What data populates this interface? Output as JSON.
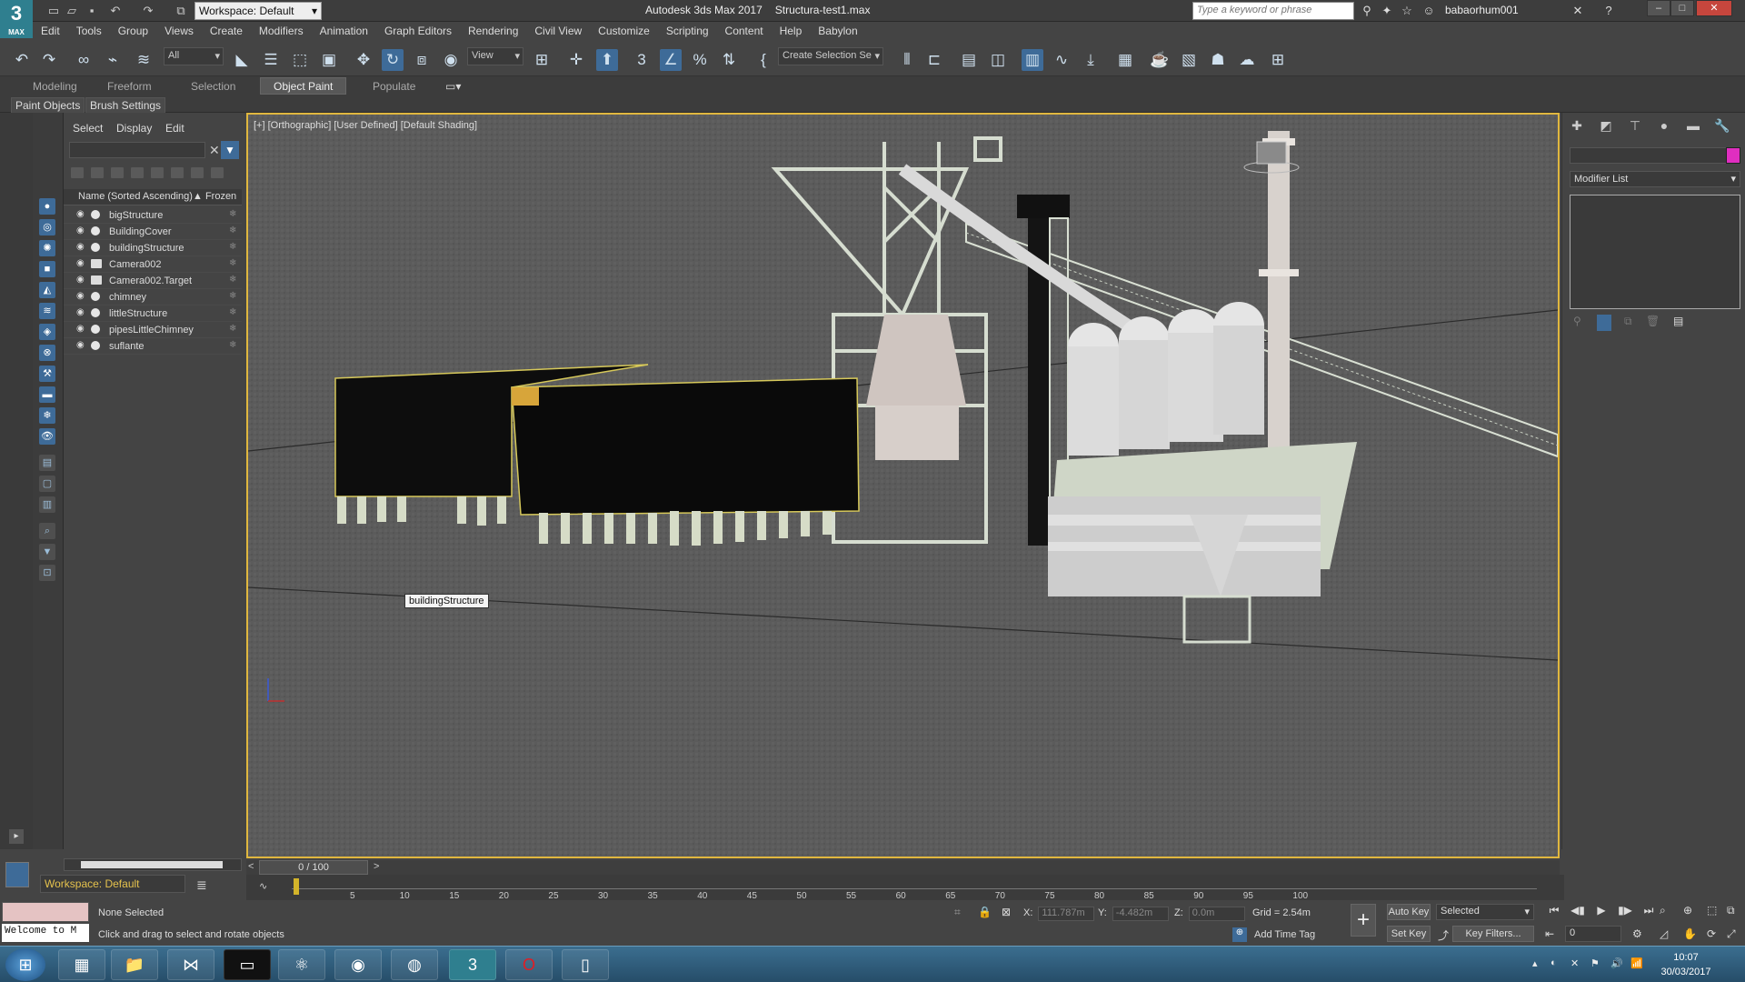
{
  "titlebar": {
    "logo_text": "3",
    "logo_sub": "MAX",
    "workspace": "Workspace: Default",
    "app_title": "Autodesk 3ds Max 2017",
    "file_name": "Structura-test1.max",
    "search_placeholder": "Type a keyword or phrase",
    "user": "babaorhum001"
  },
  "menu": [
    "Edit",
    "Tools",
    "Group",
    "Views",
    "Create",
    "Modifiers",
    "Animation",
    "Graph Editors",
    "Rendering",
    "Civil View",
    "Customize",
    "Scripting",
    "Content",
    "Help",
    "Babylon"
  ],
  "toolbar": {
    "filter": "All",
    "ref_coord": "View",
    "selection_set": "Create Selection Se"
  },
  "ribbon": {
    "tabs": [
      "Modeling",
      "Freeform",
      "Selection",
      "Object Paint",
      "Populate"
    ],
    "active": "Object Paint",
    "sub": [
      "Paint Objects",
      "Brush Settings"
    ]
  },
  "scene_explorer": {
    "tabs": [
      "Select",
      "Display",
      "Edit"
    ],
    "col_name": "Name (Sorted Ascending)",
    "col_frozen": "▲ Frozen",
    "objects": [
      {
        "name": "bigStructure",
        "type": "geo"
      },
      {
        "name": "BuildingCover",
        "type": "geo"
      },
      {
        "name": "buildingStructure",
        "type": "geo"
      },
      {
        "name": "Camera002",
        "type": "cam"
      },
      {
        "name": "Camera002.Target",
        "type": "cam"
      },
      {
        "name": "chimney",
        "type": "geo"
      },
      {
        "name": "littleStructure",
        "type": "geo"
      },
      {
        "name": "pipesLittleChimney",
        "type": "geo"
      },
      {
        "name": "suflante",
        "type": "geo"
      }
    ],
    "workspace_bottom": "Workspace: Default"
  },
  "viewport": {
    "label": "[+] [Orthographic] [User Defined] [Default Shading]",
    "tooltip": "buildingStructure",
    "accent": "#e0b73f"
  },
  "timeline": {
    "frame": "0 / 100",
    "ticks": [
      "5",
      "10",
      "15",
      "20",
      "25",
      "30",
      "35",
      "40",
      "45",
      "50",
      "55",
      "60",
      "65",
      "70",
      "75",
      "80",
      "85",
      "90",
      "95",
      "100"
    ]
  },
  "command_panel": {
    "modifier_list": "Modifier List",
    "object_color": "#e02ec0"
  },
  "status": {
    "welcome": "Welcome to M",
    "selection": "None Selected",
    "prompt": "Click and drag to select and rotate objects",
    "x_label": "X:",
    "x_val": "111.787m",
    "y_label": "Y:",
    "y_val": "-4.482m",
    "z_label": "Z:",
    "z_val": "0.0m",
    "grid": "Grid = 2.54m",
    "add_time_tag": "Add Time Tag",
    "auto_key": "Auto Key",
    "set_key": "Set Key",
    "selected": "Selected",
    "key_filters": "Key Filters...",
    "current_frame": "0"
  },
  "taskbar": {
    "time": "10:07",
    "date": "30/03/2017"
  }
}
